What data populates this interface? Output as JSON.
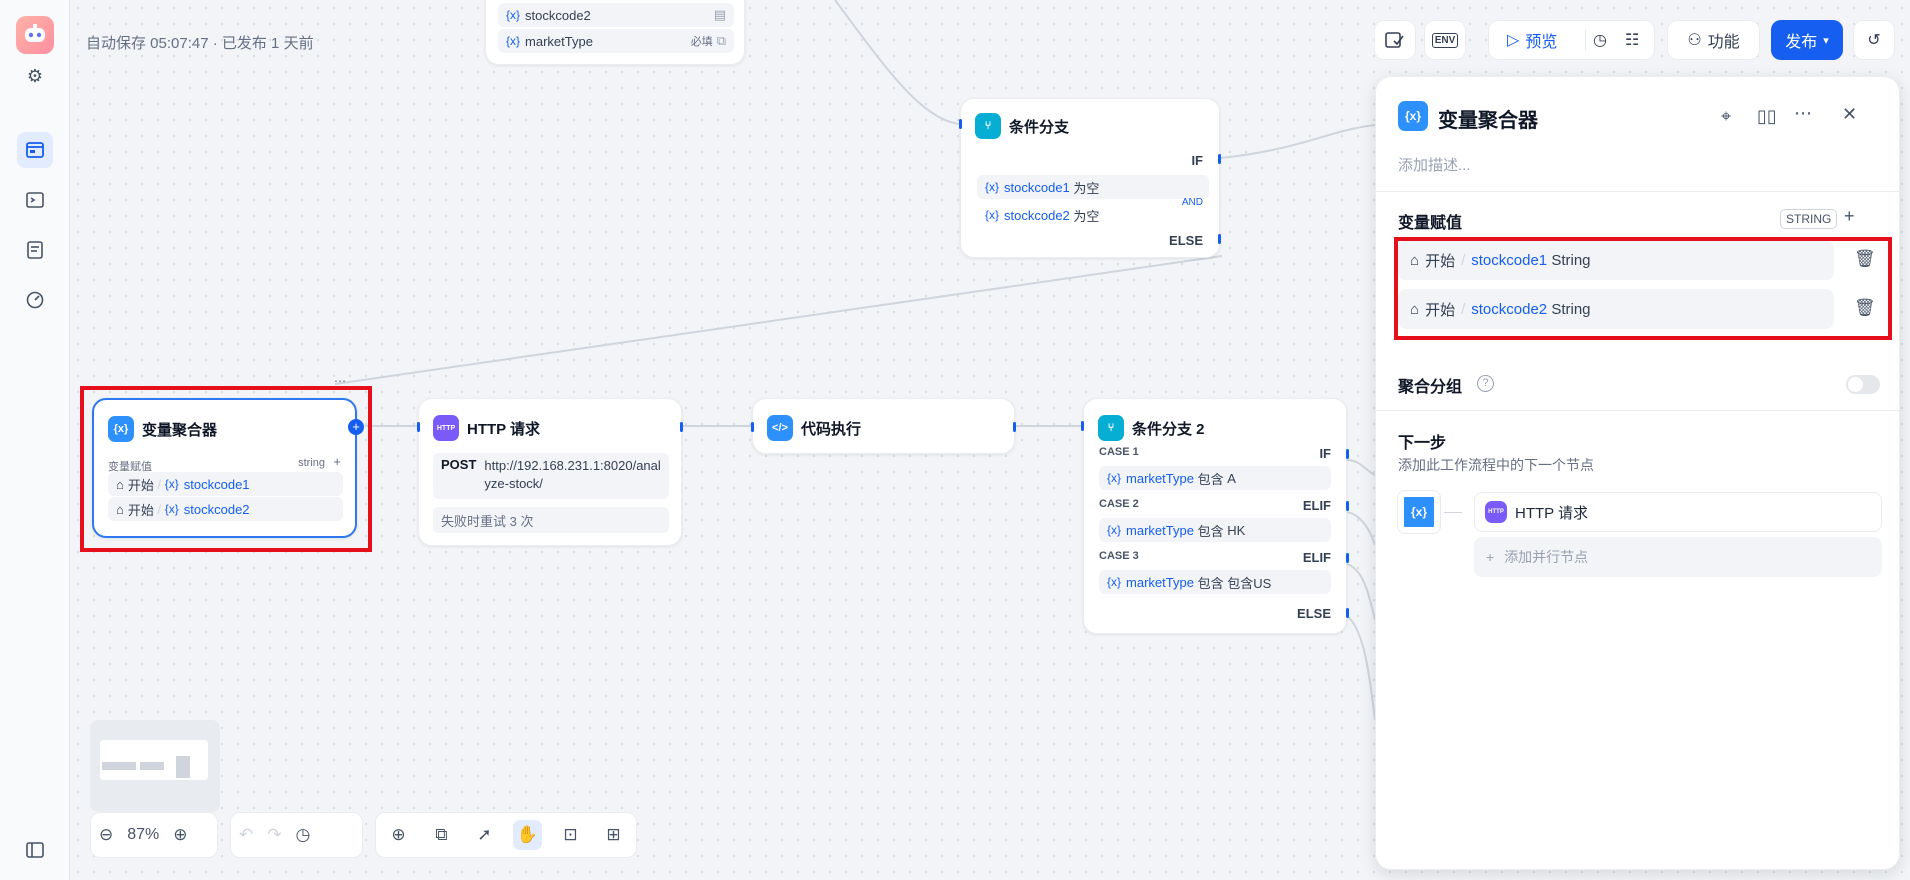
{
  "header": {
    "autosave": "自动保存 05:07:47 · 已发布 1 天前"
  },
  "toolbar": {
    "preview": "预览",
    "features": "功能",
    "publish": "发布",
    "env": "ENV"
  },
  "start_node_fragment": {
    "items": [
      {
        "name": "stockcode2",
        "badge": ""
      },
      {
        "name": "marketType",
        "badge": "必填"
      }
    ]
  },
  "cond1": {
    "title": "条件分支",
    "if": "IF",
    "and": "AND",
    "else": "ELSE",
    "conds": [
      {
        "var": "stockcode1",
        "op": "为空"
      },
      {
        "var": "stockcode2",
        "op": "为空"
      }
    ]
  },
  "aggregator": {
    "title": "变量聚合器",
    "assign_label": "变量赋值",
    "type": "string",
    "rows": [
      {
        "src": "开始",
        "var": "stockcode1"
      },
      {
        "src": "开始",
        "var": "stockcode2"
      }
    ]
  },
  "http": {
    "title": "HTTP 请求",
    "method": "POST",
    "url": "http://192.168.231.1:8020/analyze-stock/",
    "retry": "失败时重试 3 次",
    "icon_text": "HTTP"
  },
  "code": {
    "title": "代码执行"
  },
  "cond2": {
    "title": "条件分支 2",
    "cases": [
      {
        "case": "CASE 1",
        "kw": "IF",
        "var": "marketType",
        "op": "包含",
        "val": "A"
      },
      {
        "case": "CASE 2",
        "kw": "ELIF",
        "var": "marketType",
        "op": "包含",
        "val": "HK"
      },
      {
        "case": "CASE 3",
        "kw": "ELIF",
        "var": "marketType",
        "op": "包含",
        "val": "包含US"
      }
    ],
    "else": "ELSE"
  },
  "panel": {
    "title": "变量聚合器",
    "desc_placeholder": "添加描述...",
    "assign_label": "变量赋值",
    "type_badge": "STRING",
    "rows": [
      {
        "src": "开始",
        "var": "stockcode1",
        "type": "String"
      },
      {
        "src": "开始",
        "var": "stockcode2",
        "type": "String"
      }
    ],
    "group_label": "聚合分组",
    "next_title": "下一步",
    "next_desc": "添加此工作流程中的下一个节点",
    "next_node": "HTTP 请求",
    "add_parallel": "添加并行节点"
  },
  "zoom": {
    "value": "87%"
  },
  "colors": {
    "accent": "#155eef",
    "highlight": "#e6101d"
  }
}
